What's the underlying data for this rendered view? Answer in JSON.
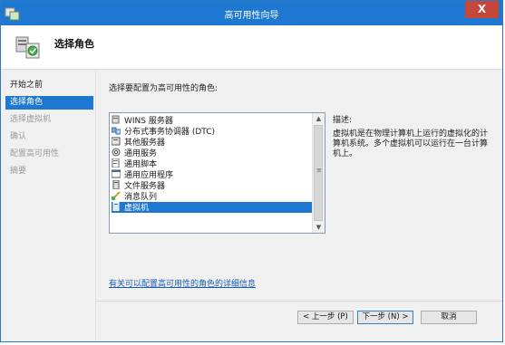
{
  "window": {
    "title": "高可用性向导",
    "close_glyph": "X"
  },
  "header": {
    "title": "选择角色",
    "icon": "cluster-role-icon"
  },
  "nav": {
    "items": [
      {
        "label": "开始之前",
        "state": "normal"
      },
      {
        "label": "选择角色",
        "state": "active"
      },
      {
        "label": "选择虚拟机",
        "state": "disabled"
      },
      {
        "label": "确认",
        "state": "disabled"
      },
      {
        "label": "配置高可用性",
        "state": "disabled"
      },
      {
        "label": "摘要",
        "state": "disabled"
      }
    ]
  },
  "content": {
    "prompt": "选择要配置为高可用性的角色:",
    "roles": [
      {
        "label": "WINS 服务器",
        "icon": "server-icon"
      },
      {
        "label": "分布式事务协调器 (DTC)",
        "icon": "dtc-icon"
      },
      {
        "label": "其他服务器",
        "icon": "server-icon"
      },
      {
        "label": "通用服务",
        "icon": "gear-icon"
      },
      {
        "label": "通用脚本",
        "icon": "script-icon"
      },
      {
        "label": "通用应用程序",
        "icon": "application-icon"
      },
      {
        "label": "文件服务器",
        "icon": "file-server-icon"
      },
      {
        "label": "消息队列",
        "icon": "message-queue-icon"
      },
      {
        "label": "虚拟机",
        "icon": "virtual-machine-icon",
        "selected": true
      }
    ],
    "description_label": "描述:",
    "description": "虚拟机是在物理计算机上运行的虚拟化的计算机系统。多个虚拟机可以运行在一台计算机上。",
    "more_info_link": "有关可以配置高可用性的角色的详细信息"
  },
  "buttons": {
    "previous": "< 上一步 (P)",
    "next": "下一步 (N) >",
    "cancel": "取消"
  },
  "colors": {
    "accent": "#1e78d1",
    "close": "#c7463a"
  }
}
